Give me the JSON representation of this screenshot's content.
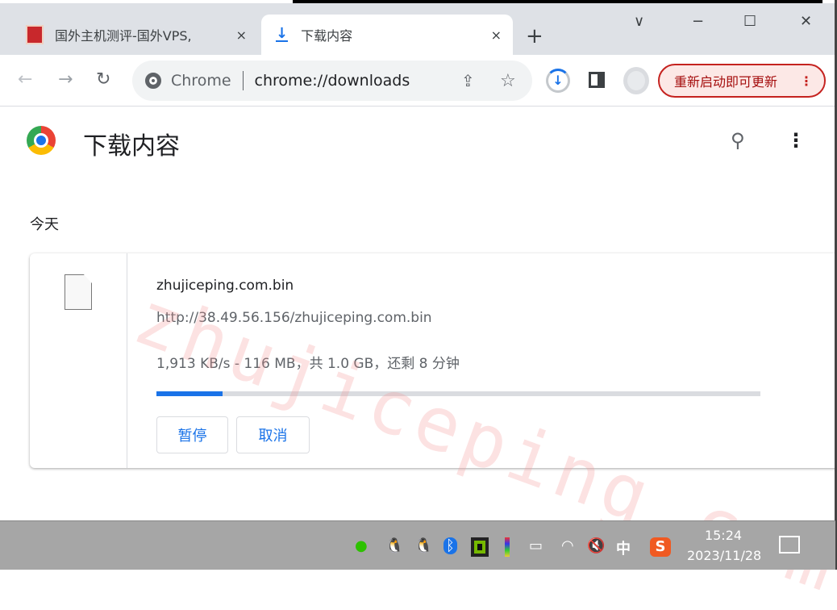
{
  "tabs": [
    {
      "title": "国外主机测评-国外VPS,",
      "close": "×"
    },
    {
      "title": "下载内容",
      "close": "×",
      "active": true
    }
  ],
  "new_tab": "+",
  "window_controls": {
    "dropdown": "∨",
    "minimize": "−",
    "maximize": "☐",
    "close": "✕"
  },
  "toolbar": {
    "site_label": "Chrome",
    "url": "chrome://downloads",
    "update_label": "重新启动即可更新"
  },
  "page": {
    "title": "下载内容",
    "section": "今天"
  },
  "download": {
    "filename": "zhujiceping.com.bin",
    "url": "http://38.49.56.156/zhujiceping.com.bin",
    "status": "1,913 KB/s - 116 MB，共 1.0 GB，还剩 8 分钟",
    "progress_percent": 11,
    "pause": "暂停",
    "cancel": "取消"
  },
  "watermark": "zhujiceping.com",
  "taskbar": {
    "ime": "中",
    "time": "15:24",
    "date": "2023/11/28"
  },
  "colors": {
    "accent": "#1a73e8",
    "update": "#c5221f"
  }
}
